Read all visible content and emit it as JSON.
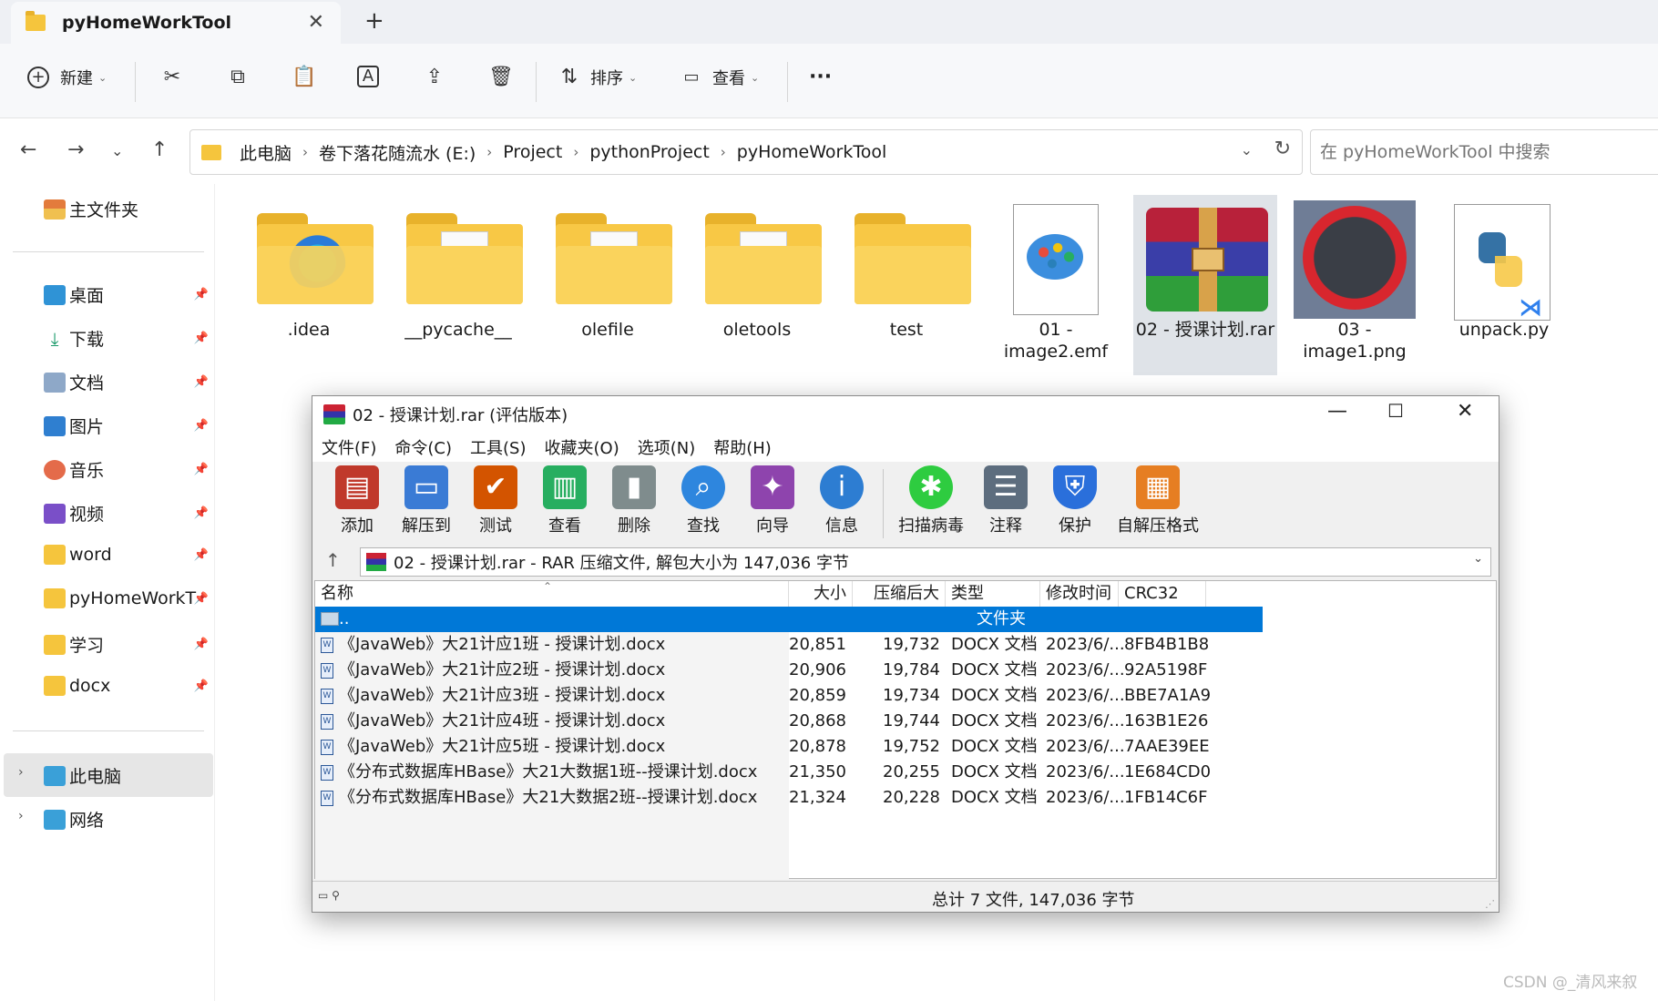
{
  "tab": {
    "title": "pyHomeWorkTool",
    "close": "✕",
    "new_tab": "+"
  },
  "cmdbar": {
    "new_label": "新建",
    "sort_label": "排序",
    "view_label": "查看",
    "more": "···"
  },
  "address": {
    "crumbs": [
      "此电脑",
      "卷下落花随流水 (E:)",
      "Project",
      "pythonProject",
      "pyHomeWorkTool"
    ],
    "search_placeholder": "在 pyHomeWorkTool 中搜索"
  },
  "sidebar": {
    "home": "主文件夹",
    "pinned": [
      {
        "label": "桌面",
        "icon": "desktop-icon"
      },
      {
        "label": "下载",
        "icon": "download-icon"
      },
      {
        "label": "文档",
        "icon": "documents-icon"
      },
      {
        "label": "图片",
        "icon": "pictures-icon"
      },
      {
        "label": "音乐",
        "icon": "music-icon"
      },
      {
        "label": "视频",
        "icon": "videos-icon"
      },
      {
        "label": "word",
        "icon": "folder-icon"
      },
      {
        "label": "pyHomeWorkT",
        "icon": "folder-icon"
      },
      {
        "label": "学习",
        "icon": "folder-icon"
      },
      {
        "label": "docx",
        "icon": "folder-icon"
      }
    ],
    "this_pc": "此电脑",
    "network": "网络"
  },
  "files": [
    {
      "name": ".idea",
      "kind": "folder"
    },
    {
      "name": "__pycache__",
      "kind": "folder"
    },
    {
      "name": "olefile",
      "kind": "folder"
    },
    {
      "name": "oletools",
      "kind": "folder"
    },
    {
      "name": "test",
      "kind": "folder"
    },
    {
      "name": "01 - image2.emf",
      "kind": "emf"
    },
    {
      "name": "02 - 授课计划.rar",
      "kind": "rar",
      "selected": true
    },
    {
      "name": "03 - image1.png",
      "kind": "png"
    },
    {
      "name": "unpack.py",
      "kind": "py"
    }
  ],
  "winrar": {
    "title": "02 - 授课计划.rar (评估版本)",
    "menu": [
      "文件(F)",
      "命令(C)",
      "工具(S)",
      "收藏夹(O)",
      "选项(N)",
      "帮助(H)"
    ],
    "tools": [
      {
        "label": "添加",
        "color": "#c0392b"
      },
      {
        "label": "解压到",
        "color": "#3a7bd5"
      },
      {
        "label": "测试",
        "color": "#d35400"
      },
      {
        "label": "查看",
        "color": "#27ae60"
      },
      {
        "label": "删除",
        "color": "#7f8c8d"
      },
      {
        "label": "查找",
        "color": "#2e86de"
      },
      {
        "label": "向导",
        "color": "#8e44ad"
      },
      {
        "label": "信息",
        "color": "#2d7dd2"
      },
      {
        "label": "扫描病毒",
        "color": "#2ecc40"
      },
      {
        "label": "注释",
        "color": "#5d6d7e"
      },
      {
        "label": "保护",
        "color": "#2a6fdb"
      },
      {
        "label": "自解压格式",
        "color": "#e67e22"
      }
    ],
    "path": "02 - 授课计划.rar - RAR 压缩文件, 解包大小为 147,036 字节",
    "columns": [
      "名称",
      "大小",
      "压缩后大小",
      "类型",
      "修改时间",
      "CRC32"
    ],
    "parent_row": {
      "name": "..",
      "type": "文件夹"
    },
    "rows": [
      {
        "name": "《JavaWeb》大21计应1班 - 授课计划.docx",
        "size": "20,851",
        "packed": "19,732",
        "type": "DOCX 文档",
        "modified": "2023/6/...",
        "crc": "8FB4B1B8"
      },
      {
        "name": "《JavaWeb》大21计应2班 - 授课计划.docx",
        "size": "20,906",
        "packed": "19,784",
        "type": "DOCX 文档",
        "modified": "2023/6/...",
        "crc": "92A5198F"
      },
      {
        "name": "《JavaWeb》大21计应3班 - 授课计划.docx",
        "size": "20,859",
        "packed": "19,734",
        "type": "DOCX 文档",
        "modified": "2023/6/...",
        "crc": "BBE7A1A9"
      },
      {
        "name": "《JavaWeb》大21计应4班 - 授课计划.docx",
        "size": "20,868",
        "packed": "19,744",
        "type": "DOCX 文档",
        "modified": "2023/6/...",
        "crc": "163B1E26"
      },
      {
        "name": "《JavaWeb》大21计应5班 - 授课计划.docx",
        "size": "20,878",
        "packed": "19,752",
        "type": "DOCX 文档",
        "modified": "2023/6/...",
        "crc": "7AAE39EE"
      },
      {
        "name": "《分布式数据库HBase》大21大数据1班--授课计划.docx",
        "size": "21,350",
        "packed": "20,255",
        "type": "DOCX 文档",
        "modified": "2023/6/...",
        "crc": "1E684CD0"
      },
      {
        "name": "《分布式数据库HBase》大21大数据2班--授课计划.docx",
        "size": "21,324",
        "packed": "20,228",
        "type": "DOCX 文档",
        "modified": "2023/6/...",
        "crc": "1FB14C6F"
      }
    ],
    "status": "总计 7 文件, 147,036 字节"
  },
  "watermark": "CSDN @_清风来叙"
}
